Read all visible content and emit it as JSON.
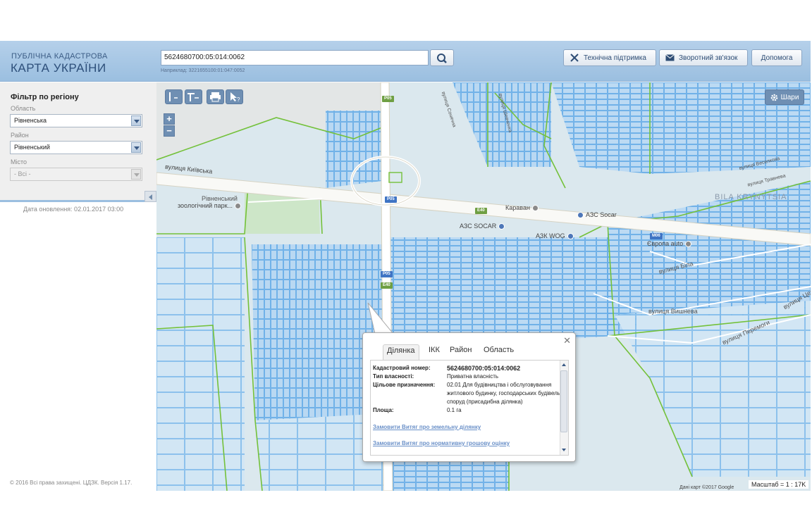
{
  "header": {
    "logo_line1": "ПУБЛІЧНА КАДАСТРОВА",
    "logo_line2": "КАРТА УКРАЇНИ",
    "search_value": "5624680700:05:014:0062",
    "search_hint": "Наприклад: 3221655100:01:047:0052",
    "buttons": {
      "support": "Технічна підтримка",
      "feedback": "Зворотний зв'язок",
      "help": "Допомога"
    }
  },
  "filter": {
    "title": "Фільтр по регіону",
    "oblast_label": "Область",
    "oblast_value": "Рівненська",
    "raion_label": "Район",
    "raion_value": "Рівненський",
    "city_label": "Місто",
    "city_value": "- Всі -"
  },
  "update_date": "Дата оновлення: 02.01.2017 03:00",
  "copyright": "© 2016 Всі права захищені. ЦДЗК. Версія 1.17.",
  "map": {
    "layers_label": "Шари",
    "attribution": "Дані карт ©2017 Google",
    "scale": "Масштаб = 1 : 17K",
    "labels": {
      "street_kyivska": "вулиця Київська",
      "zoo_line1": "Рівненський",
      "zoo_line2": "зоологічний парк...",
      "district": "BILA KRYNYTSIA",
      "karavan": "Караван",
      "azs_socar_1": "АЗС Socar",
      "azs_socar_2": "АЗС SOCAR",
      "azk_wog": "АЗК WOG",
      "europa_auto": "Європа auto",
      "vul_bila": "вулиця Біла",
      "vul_vyshneva": "вулиця Вишнева",
      "vul_peremohy": "вулиця Перемоги",
      "vul_tsentralna": "вулиця Цент...",
      "vul_veselkova": "вулиця Веселкова",
      "vul_travneva": "вулиця Травнева",
      "vul_shevchenka": "вулиця Шевченка",
      "vul_sonyachna": "вулиця Сонячна"
    },
    "shields": {
      "p05_top": "P05",
      "p05_mid": "P05",
      "p05_low": "P05",
      "e40_a": "E40",
      "e40_b": "E40",
      "m06": "M06"
    }
  },
  "popup": {
    "tabs": [
      "Ділянка",
      "ІКК",
      "Район",
      "Область"
    ],
    "active_tab": "Ділянка",
    "fields": {
      "cad_key": "Кадастровий номер:",
      "cad_val": "5624680700:05:014:0062",
      "own_key": "Тип власності:",
      "own_val": "Приватна власність",
      "use_key": "Цільове призначення:",
      "use_val": "02.01 Для будівництва і обслуговування житлового будинку, господарських будівель і споруд (присадибна ділянка)",
      "area_key": "Площа:",
      "area_val": "0.1 га"
    },
    "link1": "Замовити Витяг про земельну ділянку",
    "link2": "Замовити Витяг про нормативну грошову оцінку"
  }
}
